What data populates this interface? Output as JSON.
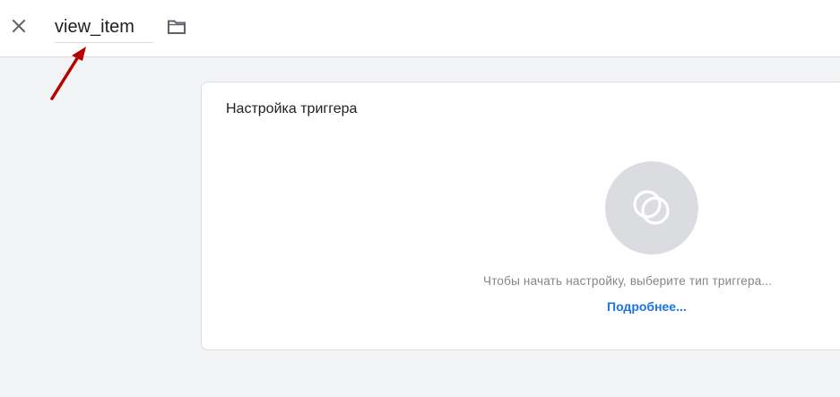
{
  "header": {
    "close_icon": "close-icon",
    "name_value": "view_item",
    "folder_icon": "folder-icon"
  },
  "card": {
    "title": "Настройка триггера",
    "trigger_icon": "trigger-type-icon",
    "hint": "Чтобы начать настройку, выберите тип триггера...",
    "learn_more": "Подробнее..."
  },
  "annotation": {
    "arrow_color": "#c00000"
  },
  "colors": {
    "background": "#f1f3f4",
    "link": "#1a73e8",
    "muted_text": "#80868b",
    "icon_circle": "#dadce0"
  }
}
